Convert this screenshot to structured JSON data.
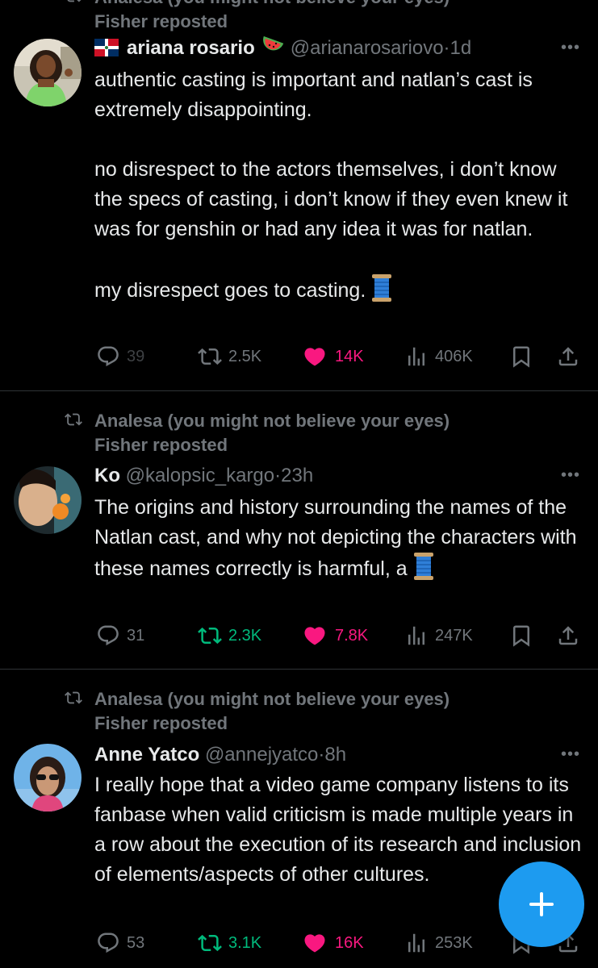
{
  "tweets": [
    {
      "reposted_by": [
        "Analesa (you might not believe your eyes)",
        "Fisher reposted"
      ],
      "name": "ariana rosario",
      "handle": "@arianarosariovo",
      "time": "1d",
      "body": [
        "authentic casting is important and natlan’s cast is extremely disappointing.",
        "no disrespect to the actors themselves, i don’t know the specs of casting, i don’t know if they even knew it was for genshin or had any idea it was for natlan.",
        "my disrespect goes to casting."
      ],
      "replies": "39",
      "reposts": "2.5K",
      "likes": "14K",
      "views": "406K"
    },
    {
      "reposted_by": [
        "Analesa (you might not believe your eyes)",
        "Fisher reposted"
      ],
      "name": "Ko",
      "handle": "@kalopsic_kargo",
      "time": "23h",
      "body": [
        "The origins and history surrounding the names of the Natlan cast, and why not depicting the characters with these names correctly is harmful, a"
      ],
      "replies": "31",
      "reposts": "2.3K",
      "likes": "7.8K",
      "views": "247K"
    },
    {
      "reposted_by": [
        "Analesa (you might not believe your eyes)",
        "Fisher reposted"
      ],
      "name": "Anne Yatco",
      "handle": "@annejyatco",
      "time": "8h",
      "body": [
        "I really hope that a video game company listens to its fanbase when valid criticism is made multiple years in a row about the execution of its research and inclusion of elements/aspects of other cultures."
      ],
      "replies": "53",
      "reposts": "3.1K",
      "likes": "16K",
      "views": "253K"
    }
  ],
  "separator_dot": "·",
  "more_label": "•••",
  "icons": {
    "repost": "repost-icon",
    "reply": "reply-icon",
    "like": "heart-icon",
    "views": "views-icon",
    "bookmark": "bookmark-icon",
    "share": "share-icon",
    "compose": "plus-icon"
  },
  "colors": {
    "background": "#000000",
    "text": "#e7e9ea",
    "muted": "#71767b",
    "like": "#f91880",
    "repost_active": "#00ba7c",
    "accent": "#1d9bf0"
  }
}
